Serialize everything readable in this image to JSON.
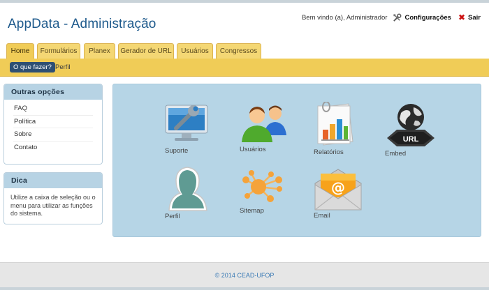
{
  "header": {
    "title": "AppData - Administração",
    "welcome": "Bem vindo (a), Administrador",
    "settings_label": "Configurações",
    "logout_label": "Sair"
  },
  "tabs": [
    {
      "label": "Home",
      "active": true
    },
    {
      "label": "Formulários"
    },
    {
      "label": "Planex"
    },
    {
      "label": "Gerador de URL"
    },
    {
      "label": "Usuários"
    },
    {
      "label": "Congressos"
    }
  ],
  "subnav": {
    "action_label": "O que fazer?",
    "profile_label": "Perfil"
  },
  "sidebar": {
    "options_title": "Outras opções",
    "options": [
      "FAQ",
      "Política",
      "Sobre",
      "Contato"
    ],
    "tip_title": "Dica",
    "tip_text": "Utilize a caixa de seleção ou o menu para utilizar as funções do sistema."
  },
  "tiles": [
    {
      "label": "Suporte",
      "icon": "support-monitor-icon"
    },
    {
      "label": "Usuários",
      "icon": "users-icon"
    },
    {
      "label": "Relatórios",
      "icon": "reports-icon"
    },
    {
      "label": "Embed",
      "icon": "url-globe-icon"
    },
    {
      "label": "Perfil",
      "icon": "profile-icon"
    },
    {
      "label": "Sitemap",
      "icon": "sitemap-icon"
    },
    {
      "label": "Email",
      "icon": "email-icon"
    }
  ],
  "footer": {
    "text": "© 2014 CEAD-UFOP"
  },
  "colors": {
    "accent": "#f0cc57",
    "panel": "#b6d5e6",
    "title": "#1e5a8c",
    "button": "#2e4f73"
  }
}
